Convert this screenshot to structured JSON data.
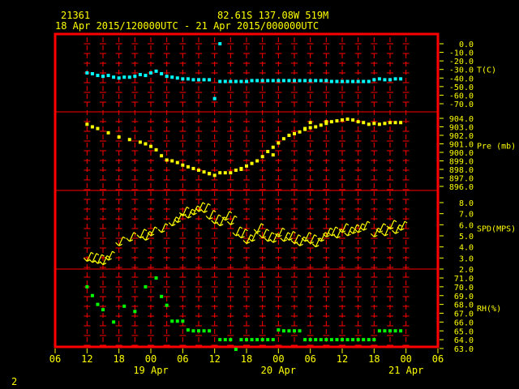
{
  "header": {
    "station_id": "21361",
    "location": "82.61S  137.08W   519M",
    "time_range": "18 Apr 2015/120000UTC - 21 Apr 2015/000000UTC"
  },
  "footer": {
    "frame_number": "2"
  },
  "colors": {
    "background": "#000000",
    "frame": "#ff0000",
    "text": "#ffff00",
    "grid_ticks": "#ff0000",
    "temperature": "#00ffff",
    "pressure": "#ffff00",
    "wind": "#ffff00",
    "humidity": "#00ff00"
  },
  "chart_data": {
    "type": "scatter",
    "x_axis": {
      "unit": "hour offset from 18 Apr 2015 00 UTC",
      "range": [
        6,
        78
      ],
      "tick_labels": [
        "06",
        "12",
        "18",
        "00",
        "06",
        "12",
        "18",
        "00",
        "06",
        "12",
        "18",
        "00",
        "06"
      ],
      "tick_values": [
        6,
        12,
        18,
        24,
        30,
        36,
        42,
        48,
        54,
        60,
        66,
        72,
        78
      ],
      "date_labels": [
        {
          "label": "19 Apr",
          "at": 24
        },
        {
          "label": "20 Apr",
          "at": 48
        },
        {
          "label": "21 Apr",
          "at": 72
        }
      ]
    },
    "panels": [
      {
        "id": "temperature",
        "label": "T(C)",
        "ylim": [
          -70,
          0
        ],
        "tick_labels": [
          "0.0",
          "-10.0",
          "-20.0",
          "-30.0",
          "-40.0",
          "-50.0",
          "-60.0",
          "-70.0"
        ],
        "tick_values": [
          0,
          -10,
          -20,
          -30,
          -40,
          -50,
          -60,
          -70
        ],
        "label_at": -30,
        "points": [
          [
            12,
            -34
          ],
          [
            13,
            -35
          ],
          [
            14,
            -37
          ],
          [
            15,
            -38
          ],
          [
            16,
            -37
          ],
          [
            17,
            -39
          ],
          [
            18,
            -40
          ],
          [
            19,
            -39
          ],
          [
            20,
            -39
          ],
          [
            21,
            -38
          ],
          [
            22,
            -36
          ],
          [
            23,
            -37
          ],
          [
            24,
            -34
          ],
          [
            25,
            -32
          ],
          [
            26,
            -35
          ],
          [
            27,
            -38
          ],
          [
            28,
            -39
          ],
          [
            29,
            -40
          ],
          [
            30,
            -41
          ],
          [
            31,
            -41
          ],
          [
            32,
            -42
          ],
          [
            33,
            -42
          ],
          [
            34,
            -42
          ],
          [
            35,
            -42
          ],
          [
            36,
            -64
          ],
          [
            37,
            -44
          ],
          [
            38,
            -44
          ],
          [
            39,
            -44
          ],
          [
            40,
            -44
          ],
          [
            41,
            -44
          ],
          [
            42,
            -44
          ],
          [
            43,
            -43
          ],
          [
            44,
            -43
          ],
          [
            45,
            -43
          ],
          [
            46,
            -43
          ],
          [
            47,
            -43
          ],
          [
            48,
            -43
          ],
          [
            49,
            -43
          ],
          [
            50,
            -43
          ],
          [
            51,
            -43
          ],
          [
            52,
            -43
          ],
          [
            53,
            -43
          ],
          [
            54,
            -43
          ],
          [
            55,
            -43
          ],
          [
            56,
            -43
          ],
          [
            57,
            -43
          ],
          [
            58,
            -44
          ],
          [
            59,
            -44
          ],
          [
            60,
            -44
          ],
          [
            61,
            -44
          ],
          [
            62,
            -44
          ],
          [
            63,
            -44
          ],
          [
            64,
            -44
          ],
          [
            65,
            -44
          ],
          [
            66,
            -42
          ],
          [
            67,
            -41
          ],
          [
            68,
            -42
          ],
          [
            69,
            -42
          ],
          [
            70,
            -41
          ],
          [
            71,
            -41
          ]
        ],
        "outliers": [
          [
            37,
            0
          ]
        ]
      },
      {
        "id": "pressure",
        "label": "Pre (mb)",
        "ylim": [
          896,
          904
        ],
        "tick_labels": [
          "904.0",
          "903.0",
          "902.0",
          "901.0",
          "900.0",
          "899.0",
          "898.0",
          "897.0",
          "896.0"
        ],
        "tick_values": [
          904,
          903,
          902,
          901,
          900,
          899,
          898,
          897,
          896
        ],
        "label_at": 900.8,
        "points": [
          [
            12,
            903.3
          ],
          [
            13,
            903.0
          ],
          [
            14,
            902.8
          ],
          [
            16,
            902.3
          ],
          [
            18,
            901.8
          ],
          [
            20,
            901.5
          ],
          [
            22,
            901.2
          ],
          [
            23,
            901.0
          ],
          [
            24,
            900.7
          ],
          [
            25,
            900.3
          ],
          [
            26,
            899.6
          ],
          [
            27,
            899.1
          ],
          [
            28,
            899.0
          ],
          [
            29,
            898.8
          ],
          [
            30,
            898.5
          ],
          [
            31,
            898.3
          ],
          [
            32,
            898.1
          ],
          [
            33,
            897.9
          ],
          [
            34,
            897.7
          ],
          [
            35,
            897.5
          ],
          [
            36,
            897.3
          ],
          [
            37,
            897.6
          ],
          [
            38,
            897.6
          ],
          [
            39,
            897.6
          ],
          [
            40,
            897.9
          ],
          [
            41,
            898.1
          ],
          [
            42,
            898.4
          ],
          [
            43,
            898.7
          ],
          [
            44,
            899.0
          ],
          [
            45,
            899.5
          ],
          [
            46,
            900.1
          ],
          [
            47,
            900.6
          ],
          [
            48,
            901.1
          ],
          [
            49,
            901.6
          ],
          [
            50,
            902.0
          ],
          [
            51,
            902.2
          ],
          [
            52,
            902.4
          ],
          [
            53,
            902.7
          ],
          [
            54,
            902.9
          ],
          [
            55,
            903.0
          ],
          [
            56,
            903.2
          ],
          [
            57,
            903.4
          ],
          [
            58,
            903.6
          ],
          [
            59,
            903.7
          ],
          [
            60,
            903.8
          ],
          [
            61,
            903.9
          ],
          [
            62,
            903.8
          ],
          [
            63,
            903.6
          ],
          [
            64,
            903.5
          ],
          [
            65,
            903.3
          ],
          [
            66,
            903.4
          ],
          [
            67,
            903.3
          ],
          [
            68,
            903.4
          ],
          [
            69,
            903.5
          ],
          [
            70,
            903.5
          ],
          [
            71,
            903.5
          ]
        ],
        "extra_points": [
          [
            35,
            897.5
          ],
          [
            41,
            898.0
          ],
          [
            47,
            899.7
          ],
          [
            53,
            902.8
          ],
          [
            54,
            903.5
          ],
          [
            57,
            903.6
          ]
        ]
      },
      {
        "id": "wind_speed",
        "label": "SPD(MPS)",
        "ylim": [
          2,
          8
        ],
        "tick_labels": [
          "8.0",
          "7.0",
          "6.0",
          "5.0",
          "4.0",
          "3.0",
          "2.0"
        ],
        "tick_values": [
          8,
          7,
          6,
          5,
          4,
          3,
          2
        ],
        "label_at": 5.7,
        "barbs": [
          [
            12,
            2.7
          ],
          [
            13,
            2.6
          ],
          [
            14,
            2.5
          ],
          [
            15,
            2.4
          ],
          [
            16,
            2.8
          ],
          [
            18,
            4.1
          ],
          [
            20,
            4.5
          ],
          [
            22,
            4.8
          ],
          [
            23,
            4.6
          ],
          [
            24,
            5.0
          ],
          [
            26,
            5.3
          ],
          [
            28,
            5.9
          ],
          [
            29,
            6.2
          ],
          [
            30,
            6.8
          ],
          [
            31,
            6.6
          ],
          [
            32,
            6.9
          ],
          [
            33,
            7.2
          ],
          [
            34,
            7.1
          ],
          [
            35,
            6.5
          ],
          [
            36,
            6.1
          ],
          [
            37,
            5.9
          ],
          [
            38,
            6.4
          ],
          [
            39,
            6.0
          ],
          [
            40,
            5.0
          ],
          [
            41,
            4.8
          ],
          [
            42,
            4.3
          ],
          [
            43,
            4.5
          ],
          [
            44,
            5.3
          ],
          [
            45,
            4.8
          ],
          [
            46,
            4.5
          ],
          [
            47,
            4.4
          ],
          [
            48,
            4.9
          ],
          [
            49,
            4.5
          ],
          [
            50,
            4.6
          ],
          [
            51,
            4.3
          ],
          [
            52,
            4.1
          ],
          [
            53,
            4.5
          ],
          [
            54,
            4.3
          ],
          [
            55,
            4.0
          ],
          [
            56,
            4.5
          ],
          [
            57,
            4.9
          ],
          [
            58,
            5.0
          ],
          [
            59,
            4.8
          ],
          [
            60,
            5.3
          ],
          [
            61,
            5.0
          ],
          [
            62,
            5.2
          ],
          [
            63,
            5.3
          ],
          [
            64,
            5.5
          ],
          [
            66,
            4.9
          ],
          [
            67,
            5.3
          ],
          [
            68,
            5.0
          ],
          [
            69,
            5.6
          ],
          [
            70,
            5.2
          ],
          [
            71,
            5.5
          ]
        ]
      },
      {
        "id": "humidity",
        "label": "RH(%)",
        "ylim": [
          63,
          71
        ],
        "tick_labels": [
          "71.0",
          "70.0",
          "69.0",
          "68.0",
          "67.0",
          "66.0",
          "65.0",
          "64.0",
          "63.0"
        ],
        "tick_values": [
          71,
          70,
          69,
          68,
          67,
          66,
          65,
          64,
          63
        ],
        "label_at": 67.6,
        "points": [
          [
            12,
            70.0
          ],
          [
            13,
            69.0
          ],
          [
            14,
            68.0
          ],
          [
            15,
            67.4
          ],
          [
            17,
            66.0
          ],
          [
            19,
            67.8
          ],
          [
            21,
            67.2
          ],
          [
            23,
            70.0
          ],
          [
            25,
            71.0
          ],
          [
            26,
            68.9
          ],
          [
            27,
            67.9
          ],
          [
            28,
            66.1
          ],
          [
            29,
            66.1
          ],
          [
            30,
            66.1
          ],
          [
            31,
            65.1
          ],
          [
            32,
            65.0
          ],
          [
            33,
            65.0
          ],
          [
            34,
            65.0
          ],
          [
            35,
            65.0
          ],
          [
            37,
            64.0
          ],
          [
            38,
            64.0
          ],
          [
            39,
            64.0
          ],
          [
            40,
            62.9
          ],
          [
            41,
            64.0
          ],
          [
            42,
            64.0
          ],
          [
            43,
            64.0
          ],
          [
            44,
            64.0
          ],
          [
            45,
            64.0
          ],
          [
            46,
            64.0
          ],
          [
            47,
            64.0
          ],
          [
            48,
            65.1
          ],
          [
            49,
            65.0
          ],
          [
            50,
            65.0
          ],
          [
            51,
            65.0
          ],
          [
            52,
            65.0
          ],
          [
            53,
            64.0
          ],
          [
            54,
            64.0
          ],
          [
            55,
            64.0
          ],
          [
            56,
            64.0
          ],
          [
            57,
            64.0
          ],
          [
            58,
            64.0
          ],
          [
            59,
            64.0
          ],
          [
            60,
            64.0
          ],
          [
            61,
            64.0
          ],
          [
            62,
            64.0
          ],
          [
            63,
            64.0
          ],
          [
            64,
            64.0
          ],
          [
            65,
            64.0
          ],
          [
            66,
            64.0
          ],
          [
            67,
            65.0
          ],
          [
            68,
            65.0
          ],
          [
            69,
            65.0
          ],
          [
            70,
            65.0
          ],
          [
            71,
            65.0
          ]
        ]
      }
    ]
  }
}
